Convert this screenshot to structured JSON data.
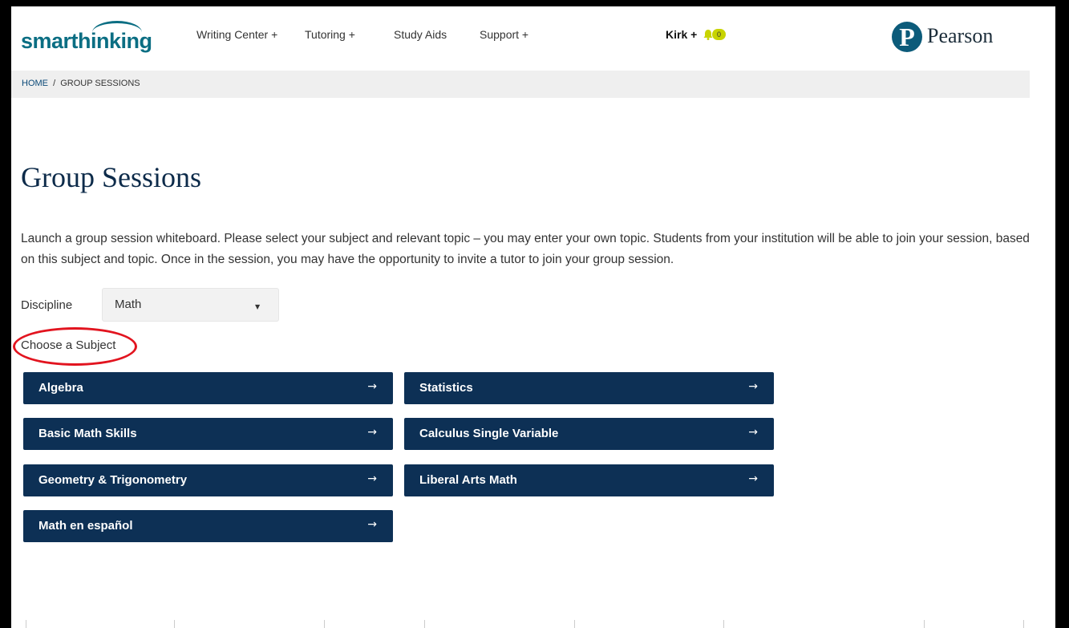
{
  "header": {
    "logo": "smarthinking",
    "nav": [
      "Writing Center +",
      "Tutoring +",
      "Study Aids",
      "Support +"
    ],
    "user": "Kirk +",
    "notification_count": "0",
    "brand": "Pearson",
    "brand_mark": "P"
  },
  "breadcrumb": {
    "home": "HOME",
    "separator": "/",
    "current": "GROUP SESSIONS"
  },
  "main": {
    "title": "Group Sessions",
    "description": "Launch a group session whiteboard. Please select your subject and relevant topic – you may enter your own topic. Students from your institution will be able to join your session, based on this subject and topic. Once in the session, you may have the opportunity to invite a tutor to join your group session.",
    "discipline_label": "Discipline",
    "discipline_value": "Math",
    "choose_label": "Choose a Subject",
    "subjects": [
      "Algebra",
      "Statistics",
      "Basic Math Skills",
      "Calculus Single Variable",
      "Geometry & Trigonometry",
      "Liberal Arts Math",
      "Math en español"
    ],
    "arrow": "→"
  },
  "colors": {
    "brand_teal": "#0b6e83",
    "button_navy": "#0d3055",
    "title_navy": "#0d2b4a",
    "annotation_red": "#e2141f",
    "badge_yellow": "#c8d400",
    "outer_bg": "#dff2fa"
  },
  "icons": [
    "bell-icon",
    "chevron-down-icon",
    "arrow-right-icon"
  ]
}
